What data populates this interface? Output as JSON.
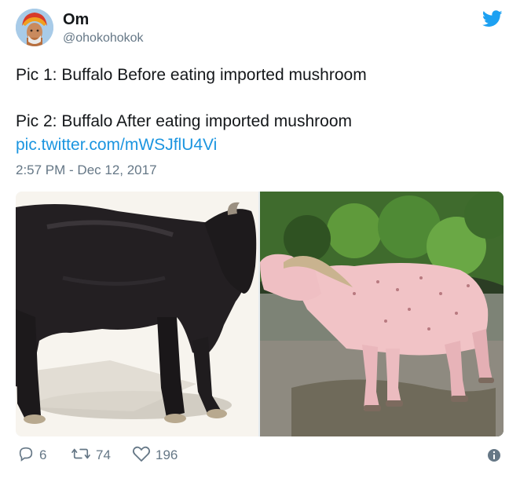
{
  "user": {
    "name": "Om",
    "handle": "@ohokohokok"
  },
  "tweet": {
    "line1": "Pic 1: Buffalo Before eating imported mushroom",
    "line2": "Pic 2: Buffalo After eating imported mushroom",
    "link": "pic.twitter.com/mWSJflU4Vi",
    "timestamp": "2:57 PM - Dec 12, 2017"
  },
  "actions": {
    "replies": "6",
    "retweets": "74",
    "likes": "196"
  },
  "icons": {
    "brand": "twitter-bird-icon",
    "reply": "reply-icon",
    "retweet": "retweet-icon",
    "like": "heart-icon",
    "info": "info-icon"
  },
  "colors": {
    "link": "#1b95e0",
    "muted": "#657786",
    "text": "#14171a",
    "brand": "#1da1f2"
  }
}
